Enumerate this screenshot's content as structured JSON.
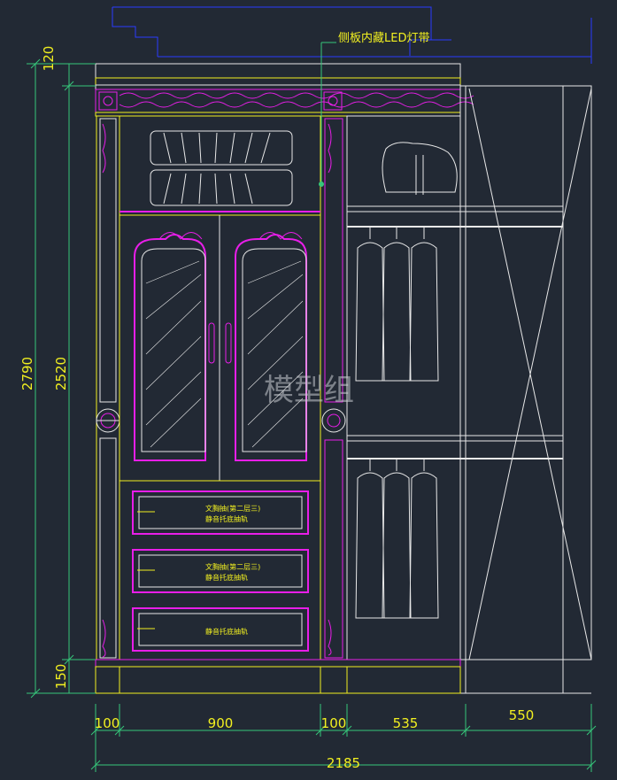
{
  "drawing": {
    "annotation_led": "侧板内藏LED灯带",
    "watermark": "模型组",
    "dimensions": {
      "height_total": "2790",
      "height_body": "2520",
      "height_top": "120",
      "height_base": "150",
      "width_left_panel": "100",
      "width_door_section": "900",
      "width_mid_panel": "100",
      "width_hanging": "535",
      "width_side": "550",
      "width_total": "2185"
    },
    "drawer_labels": {
      "d1_line1": "文胸抽(第二层三)",
      "d1_line2": "静音托底抽轨",
      "d2_line1": "文胸抽(第二层三)",
      "d2_line2": "静音托底抽轨",
      "d3_line1": "静音托底抽轨"
    }
  },
  "colors": {
    "background": "#222934",
    "yellow": "#f2f020",
    "magenta": "#e81ee8",
    "white": "#e8e8e8",
    "green": "#36c77a",
    "blue": "#2b3cff"
  }
}
